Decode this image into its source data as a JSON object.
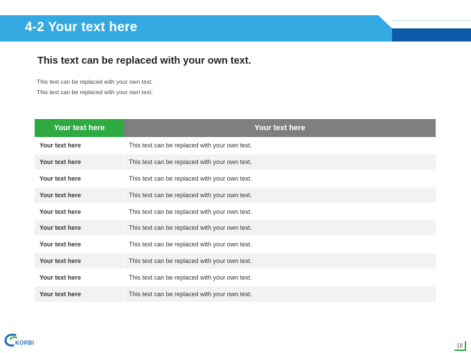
{
  "header": {
    "title": "4-2 Your text here"
  },
  "content": {
    "subtitle": "This text can be replaced with your own text.",
    "body_lines": [
      "This text can be replaced with your own text.",
      "This text can be replaced with your own text."
    ]
  },
  "table": {
    "headers": [
      "Your text here",
      "Your text here"
    ],
    "rows": [
      [
        "Your text here",
        "This text can be replaced with your own text."
      ],
      [
        "Your text here",
        "This text can be replaced with your own text."
      ],
      [
        "Your text here",
        "This text can be replaced with your own text."
      ],
      [
        "Your text here",
        "This text can be replaced with your own text."
      ],
      [
        "Your text here",
        "This text can be replaced with your own text."
      ],
      [
        "Your text here",
        "This text can be replaced with your own text."
      ],
      [
        "Your text here",
        "This text can be replaced with your own text."
      ],
      [
        "Your text here",
        "This text can be replaced with your own text."
      ],
      [
        "Your text here",
        "This text can be replaced with your own text."
      ],
      [
        "Your text here",
        "This text can be replaced with your own text."
      ]
    ]
  },
  "footer": {
    "logo_text": "KORBI",
    "page_number": "18"
  },
  "colors": {
    "banner_blue": "#34a8e0",
    "banner_dark_blue": "#0e5aa7",
    "header_green": "#2eaa42",
    "header_gray": "#7f7f7f"
  }
}
